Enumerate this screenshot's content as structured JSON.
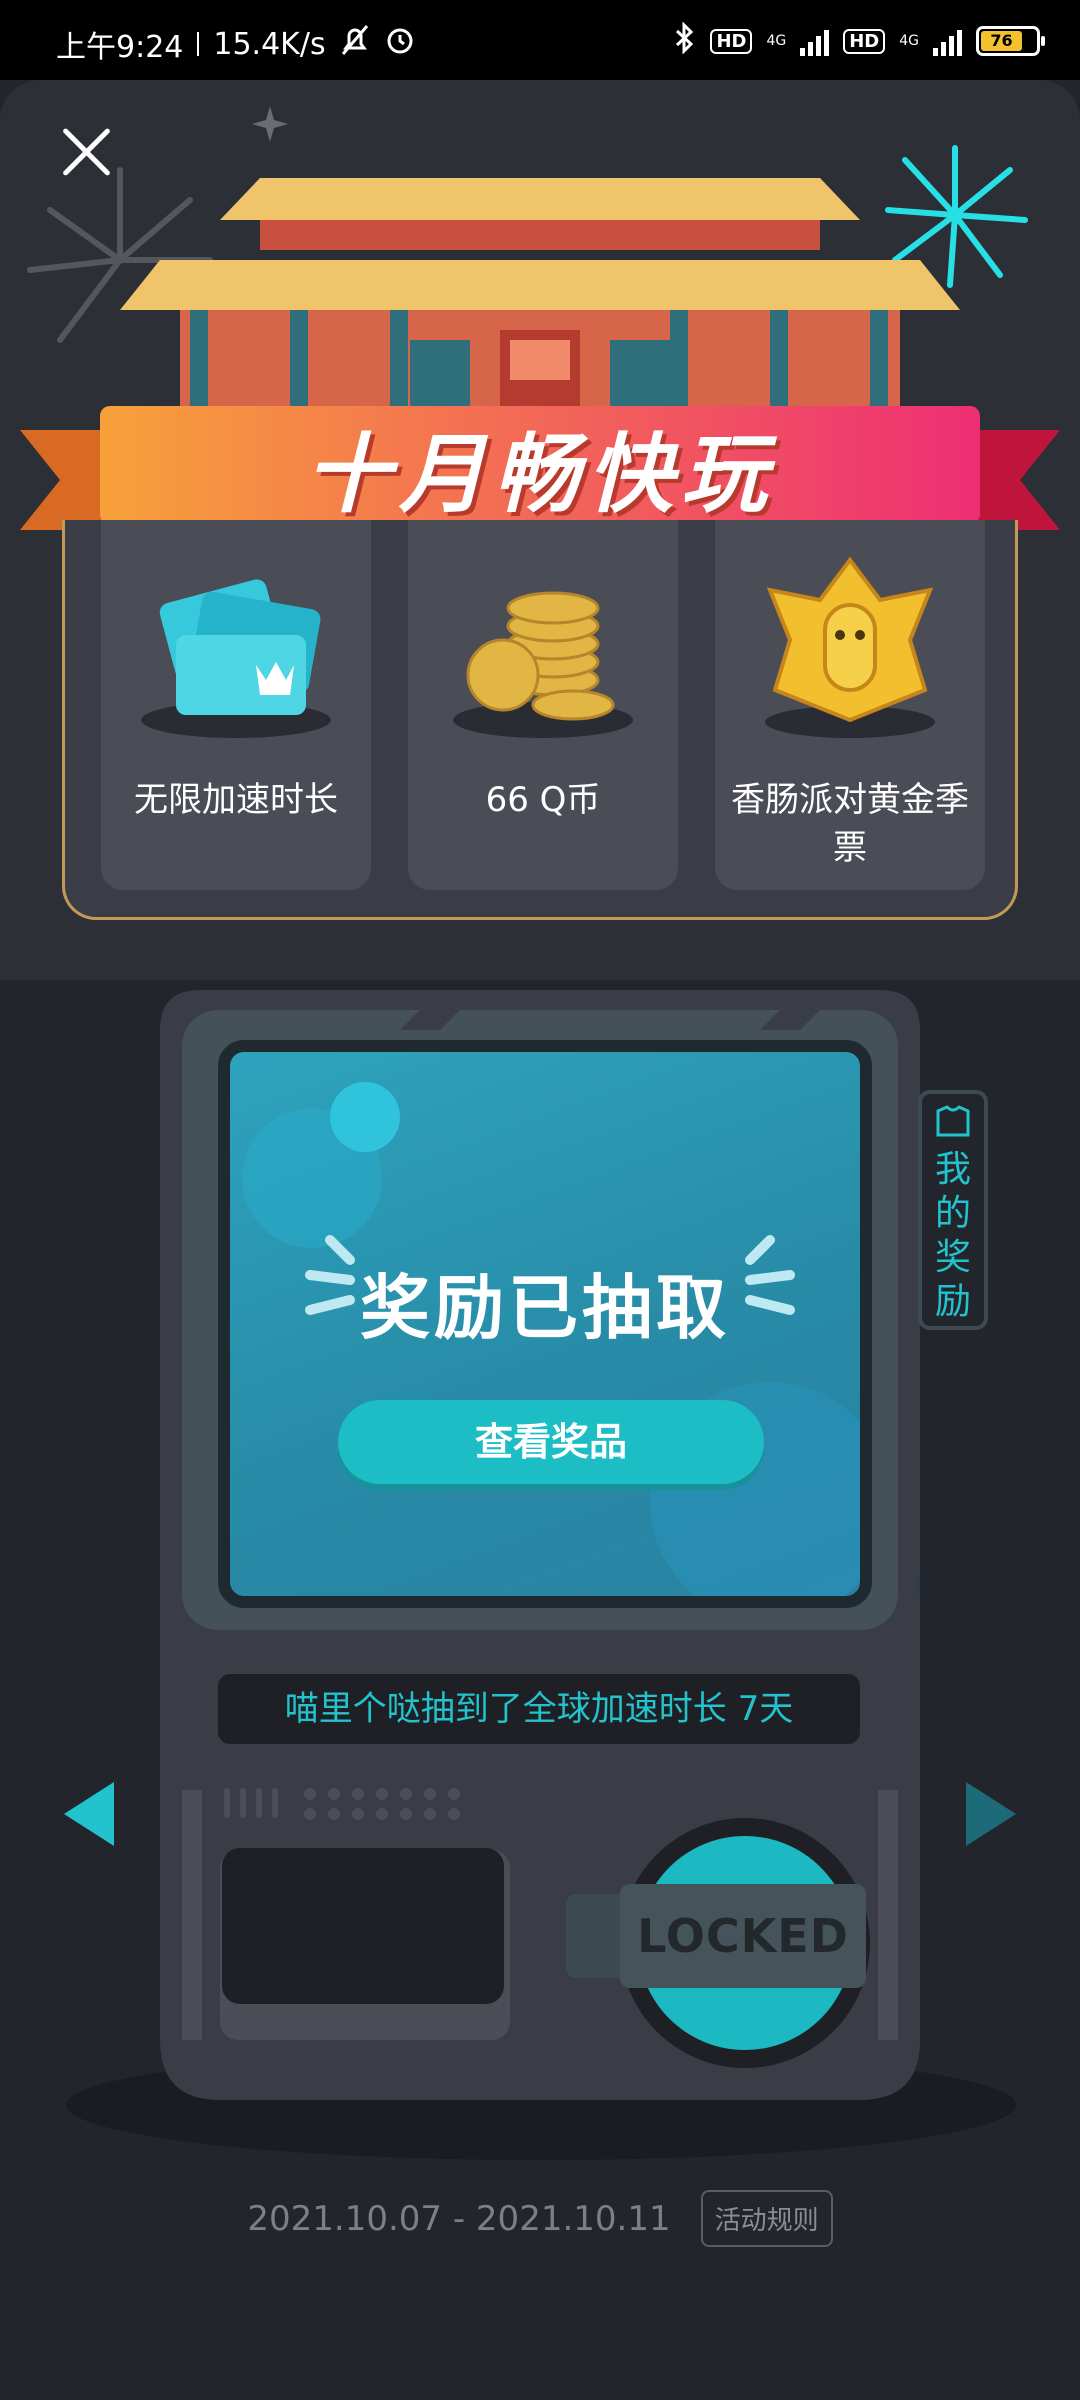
{
  "status_bar": {
    "time": "上午9:24",
    "net_speed": "15.4K/s",
    "hd1": "HD",
    "net1": "4G",
    "hd2": "HD",
    "net2": "4G",
    "battery": "76"
  },
  "header": {
    "banner_title": "十月畅快玩"
  },
  "rewards": [
    {
      "label": "无限加速时长"
    },
    {
      "label": "66 Q币"
    },
    {
      "label": "香肠派对黄金季票"
    }
  ],
  "machine": {
    "prize_status": "奖励已抽取",
    "view_button": "查看奖品",
    "my_rewards": "我的奖励",
    "ticker": "喵里个哒抽到了全球加速时长 7天",
    "locked_label": "LOCKED"
  },
  "footer": {
    "date_range": "2021.10.07 - 2021.10.11",
    "rules_label": "活动规则"
  }
}
